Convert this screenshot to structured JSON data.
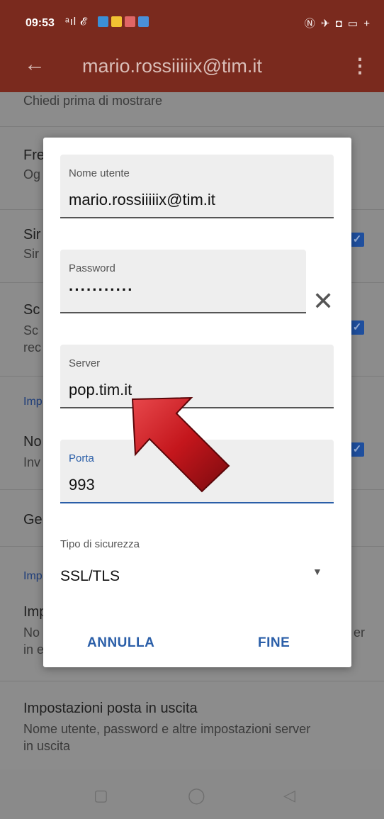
{
  "status": {
    "time": "09:53",
    "signal_text": "ᵃıl 𝓔",
    "right_icons": "Ⓝ ✈ ◘ ▭ +"
  },
  "appbar": {
    "back_icon": "arrow-left-icon",
    "title": "mario.rossiiiiix@tim.it",
    "menu_icon": "more-vert-icon"
  },
  "background": {
    "top_text": "Chiedi prima di mostrare",
    "rows": [
      {
        "title": "Fre",
        "subtitle": "Og"
      },
      {
        "title": "Sir",
        "subtitle": "Sir"
      },
      {
        "title": "Sc",
        "subtitle": "Sc",
        "subtitle2": "rec"
      },
      {
        "section": "Imp"
      },
      {
        "title": "No",
        "subtitle": "Inv"
      },
      {
        "title": "Ge"
      },
      {
        "section": "Imp"
      },
      {
        "title": "Imp",
        "subtitle": "No",
        "subtitle2": "in e",
        "trail": "er"
      }
    ],
    "outgoing_title": "Impostazioni posta in uscita",
    "outgoing_sub1": "Nome utente, password e altre impostazioni server",
    "outgoing_sub2": "in uscita"
  },
  "dialog": {
    "username": {
      "label": "Nome utente",
      "value": "mario.rossiiiiix@tim.it"
    },
    "password": {
      "label": "Password",
      "value": "···········"
    },
    "server": {
      "label": "Server",
      "value": "pop.tim.it"
    },
    "port": {
      "label": "Porta",
      "value": "993"
    },
    "security": {
      "label": "Tipo di sicurezza",
      "value": "SSL/TLS"
    },
    "cancel": "ANNULLA",
    "done": "FINE"
  },
  "colors": {
    "appbar": "#7a2a1e",
    "accent": "#2a5ea8",
    "arrow": "#c4161c"
  }
}
